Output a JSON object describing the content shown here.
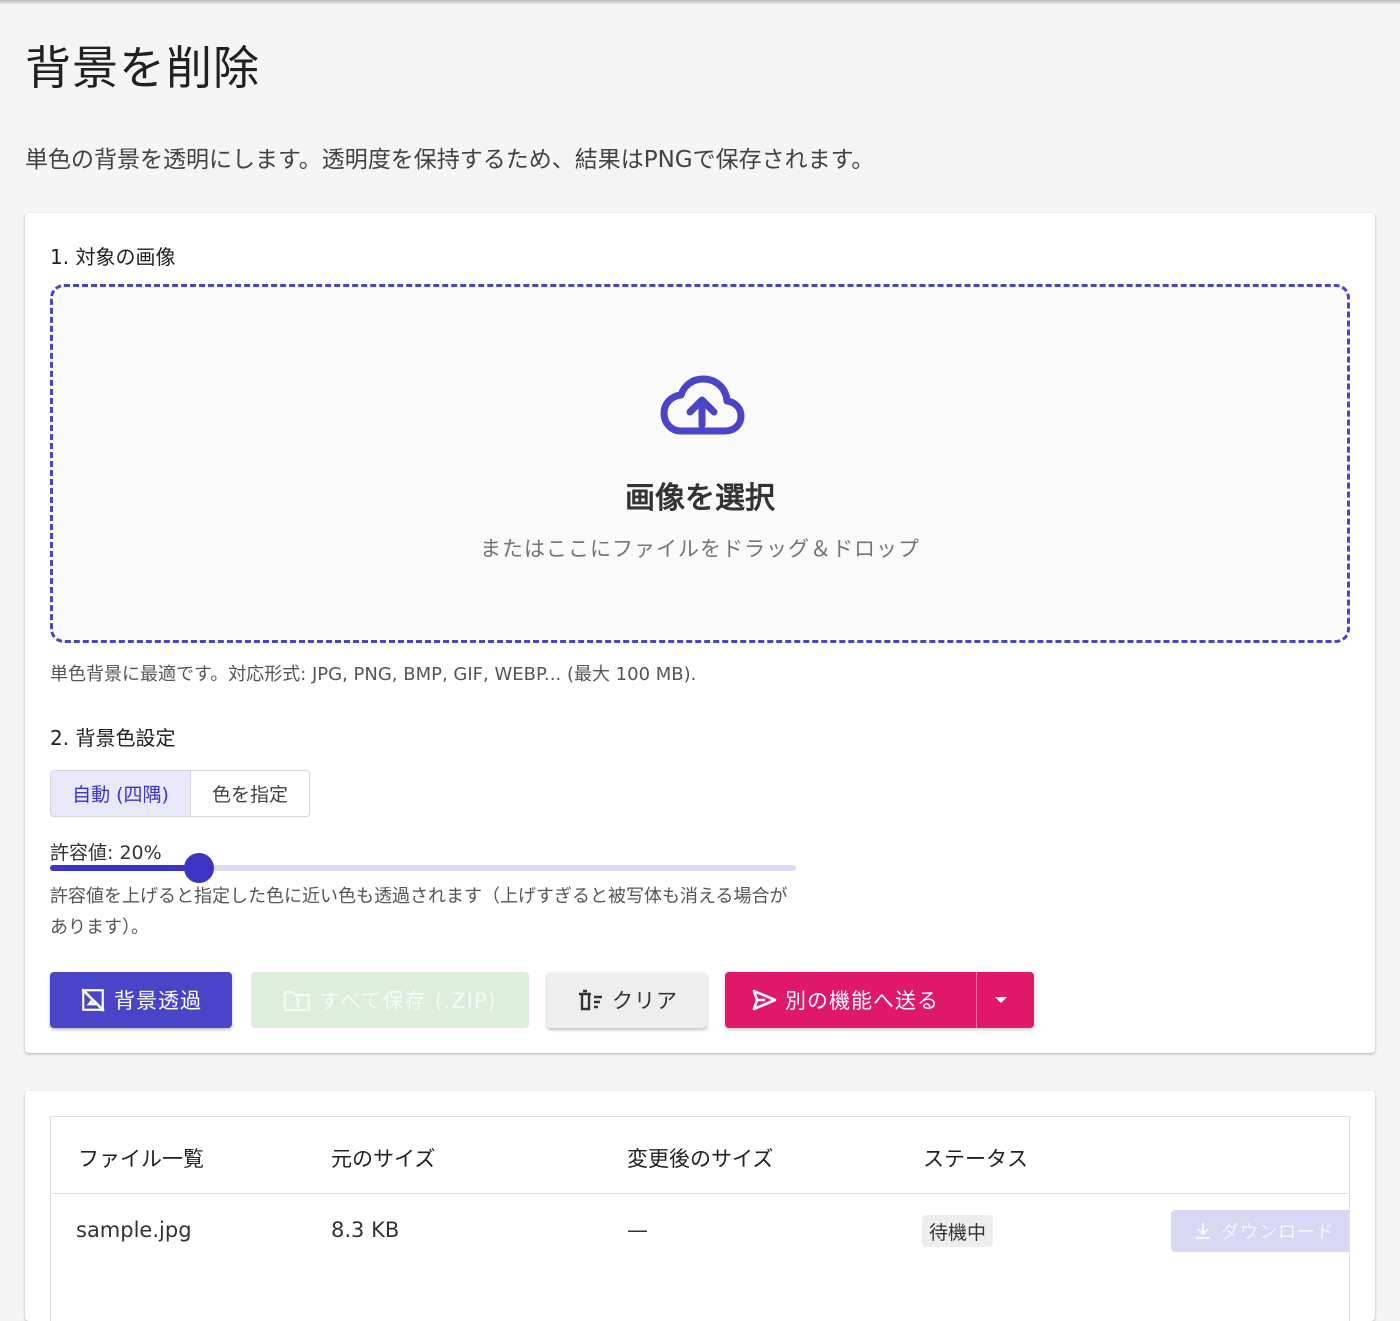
{
  "page": {
    "title": "背景を削除",
    "description": "単色の背景を透明にします。透明度を保持するため、結果はPNGで保存されます。"
  },
  "section1": {
    "label": "1. 対象の画像",
    "dropzone_title": "画像を選択",
    "dropzone_subtitle": "またはここにファイルをドラッグ＆ドロップ",
    "hint": "単色背景に最適です。対応形式: JPG, PNG, BMP, GIF, WEBP... (最大 100 MB)."
  },
  "section2": {
    "label": "2. 背景色設定",
    "toggle_auto": "自動 (四隅)",
    "toggle_color": "色を指定",
    "tolerance_label": "許容値: 20%",
    "tolerance_value": 20,
    "tolerance_help": "許容値を上げると指定した色に近い色も透過されます（上げすぎると被写体も消える場合があります）。"
  },
  "actions": {
    "remove_bg": "背景透過",
    "save_zip": "すべて保存 (.ZIP)",
    "clear": "クリア",
    "send": "別の機能へ送る"
  },
  "table": {
    "headers": [
      "ファイル一覧",
      "元のサイズ",
      "変更後のサイズ",
      "ステータス"
    ],
    "rows": [
      {
        "name": "sample.jpg",
        "original_size": "8.3 KB",
        "new_size": "—",
        "status": "待機中",
        "download_label": "ダウンロード"
      }
    ]
  },
  "colors": {
    "primary": "#4a44c8",
    "accent": "#e0186a"
  },
  "icons": {
    "upload": "cloud-upload-icon",
    "remove_bg": "hide-image-icon",
    "zip": "folder-zip-icon",
    "clear": "delete-sweep-icon",
    "send": "send-icon",
    "caret": "chevron-down-icon",
    "download": "download-icon"
  }
}
